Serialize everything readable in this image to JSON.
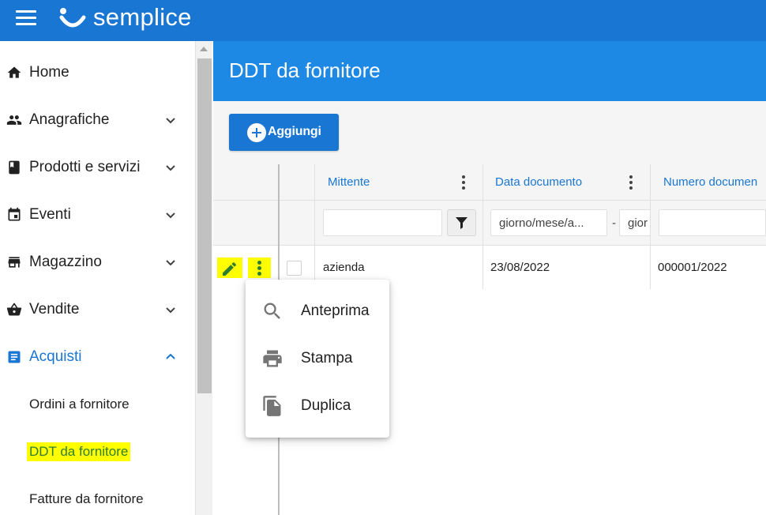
{
  "app": {
    "brand": "semplice"
  },
  "sidebar": {
    "items": [
      {
        "label": "Home",
        "icon": "home-icon",
        "expandable": false
      },
      {
        "label": "Anagrafiche",
        "icon": "people-icon",
        "expandable": true
      },
      {
        "label": "Prodotti e servizi",
        "icon": "book-icon",
        "expandable": true
      },
      {
        "label": "Eventi",
        "icon": "calendar-icon",
        "expandable": true
      },
      {
        "label": "Magazzino",
        "icon": "warehouse-icon",
        "expandable": true
      },
      {
        "label": "Vendite",
        "icon": "basket-icon",
        "expandable": true
      },
      {
        "label": "Acquisti",
        "icon": "list-icon",
        "expandable": true,
        "expanded": true
      }
    ],
    "subitems": [
      {
        "label": "Ordini a fornitore"
      },
      {
        "label": "DDT da fornitore",
        "selected": true
      },
      {
        "label": "Fatture da fornitore"
      }
    ]
  },
  "page": {
    "title": "DDT da fornitore"
  },
  "toolbar": {
    "add_label": "Aggiungi"
  },
  "grid": {
    "columns": [
      "Mittente",
      "Data documento",
      "Numero documen"
    ],
    "filters": {
      "date_from_placeholder": "giorno/mese/a...",
      "date_separator": "-",
      "date_to_placeholder": "gior"
    },
    "rows": [
      {
        "mittente": "azienda",
        "data": "23/08/2022",
        "numero": "000001/2022"
      }
    ]
  },
  "context_menu": {
    "items": [
      {
        "label": "Anteprima",
        "icon": "search-icon"
      },
      {
        "label": "Stampa",
        "icon": "print-icon"
      },
      {
        "label": "Duplica",
        "icon": "copy-icon"
      }
    ]
  },
  "colors": {
    "primary": "#1976d2",
    "header": "#1e88e5",
    "highlight": "#ffff00",
    "accent_green": "#2e7d32"
  }
}
